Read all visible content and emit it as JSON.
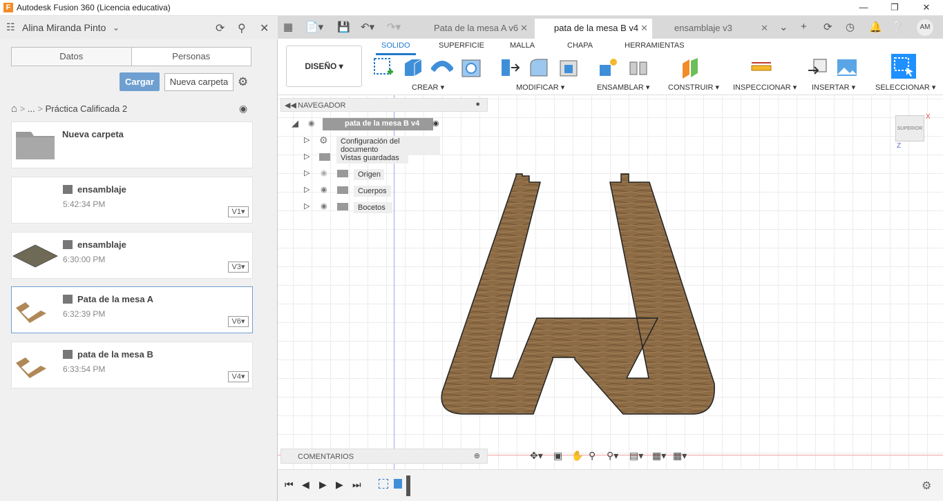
{
  "window": {
    "title": "Autodesk Fusion 360 (Licencia educativa)",
    "logo_letter": "F"
  },
  "left": {
    "user_name": "Alina Miranda Pinto",
    "tabs": [
      "Datos",
      "Personas"
    ],
    "upload_label": "Cargar",
    "new_folder_label": "Nueva carpeta",
    "breadcrumb": {
      "ellipsis": "...",
      "current": "Práctica Calificada 2"
    },
    "items": [
      {
        "name": "Nueva carpeta",
        "time": "",
        "version": ""
      },
      {
        "name": "ensamblaje",
        "time": "5:42:34 PM",
        "version": "V1"
      },
      {
        "name": "ensamblaje",
        "time": "6:30:00 PM",
        "version": "V3"
      },
      {
        "name": "Pata de la mesa A",
        "time": "6:32:39 PM",
        "version": "V6"
      },
      {
        "name": "pata de la mesa B",
        "time": "6:33:54 PM",
        "version": "V4"
      }
    ]
  },
  "doc_tabs": [
    {
      "label": "Pata de la mesa A v6"
    },
    {
      "label": "pata de la mesa B v4"
    },
    {
      "label": "ensamblaje v3"
    }
  ],
  "account_initials": "AM",
  "toolbar": {
    "workspace": "DISEÑO",
    "tabs": [
      "SOLIDO",
      "SUPERFICIE",
      "MALLA",
      "CHAPA",
      "HERRAMIENTAS"
    ],
    "groups": [
      "CREAR",
      "MODIFICAR",
      "ENSAMBLAR",
      "CONSTRUIR",
      "INSPECCIONAR",
      "INSERTAR",
      "SELECCIONAR"
    ]
  },
  "browser": {
    "title": "NAVEGADOR",
    "root": "pata de la mesa B v4",
    "nodes": [
      "Configuración del documento",
      "Vistas guardadas",
      "Origen",
      "Cuerpos",
      "Bocetos"
    ]
  },
  "comments_label": "COMENTARIOS",
  "viewcube_label": "SUPERIOR",
  "axis_labels": {
    "x": "X",
    "z": "Z"
  },
  "colors": {
    "accent": "#1e78c8",
    "upload": "#6e9fd0",
    "wood": "#8a6a45"
  }
}
